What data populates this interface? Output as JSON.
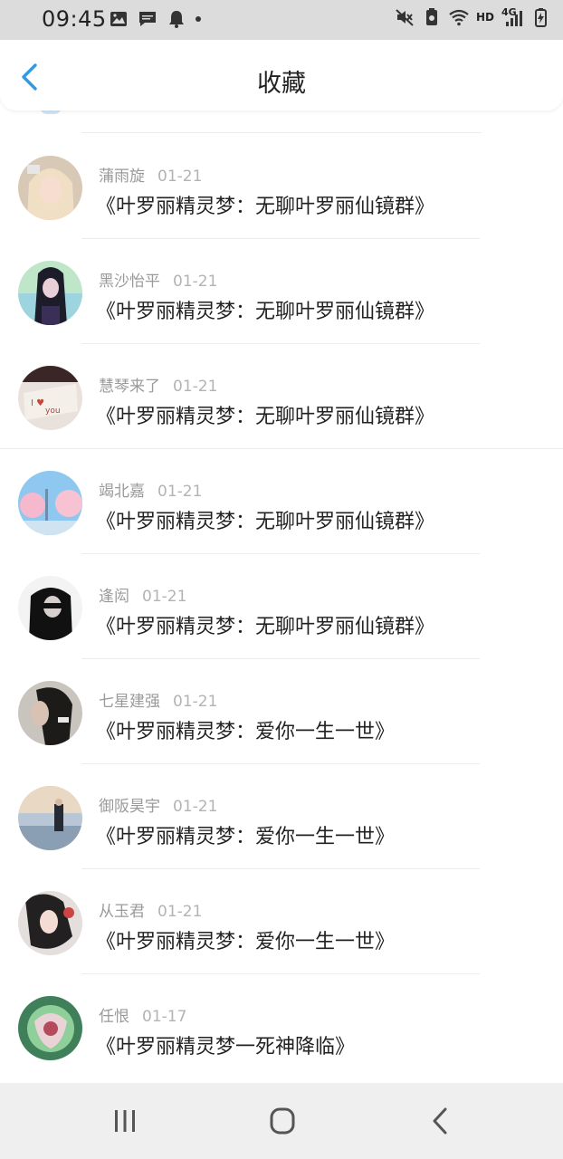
{
  "status_bar": {
    "time": "09:45",
    "left_icons": [
      "image-icon",
      "message-icon",
      "bell-icon",
      "dot-icon"
    ],
    "right_icons": [
      "mute-icon",
      "battery-saver-icon",
      "wifi-icon",
      "signal-icon",
      "battery-icon"
    ],
    "hd": "HD",
    "network": "4G"
  },
  "header": {
    "title": "收藏",
    "back_icon": "chevron-left-icon",
    "accent": "#2f9ae6"
  },
  "items": [
    {
      "name": "蒲雨旋",
      "date": "01-21",
      "text": "《叶罗丽精灵梦：无聊叶罗丽仙镜群》"
    },
    {
      "name": "黑沙怡平",
      "date": "01-21",
      "text": "《叶罗丽精灵梦：无聊叶罗丽仙镜群》"
    },
    {
      "name": "慧琴来了",
      "date": "01-21",
      "text": "《叶罗丽精灵梦：无聊叶罗丽仙镜群》"
    },
    {
      "name": "竭北嘉",
      "date": "01-21",
      "text": "《叶罗丽精灵梦：无聊叶罗丽仙镜群》"
    },
    {
      "name": "逢闳",
      "date": "01-21",
      "text": "《叶罗丽精灵梦：无聊叶罗丽仙镜群》"
    },
    {
      "name": "七星建强",
      "date": "01-21",
      "text": "《叶罗丽精灵梦：爱你一生一世》"
    },
    {
      "name": "御阪昊宇",
      "date": "01-21",
      "text": "《叶罗丽精灵梦：爱你一生一世》"
    },
    {
      "name": "从玉君",
      "date": "01-21",
      "text": "《叶罗丽精灵梦：爱你一生一世》"
    },
    {
      "name": "任恨",
      "date": "01-17",
      "text": "《叶罗丽精灵梦一死神降临》"
    }
  ],
  "nav_bar": {
    "buttons": [
      "recent-apps-icon",
      "home-icon",
      "back-icon"
    ]
  }
}
